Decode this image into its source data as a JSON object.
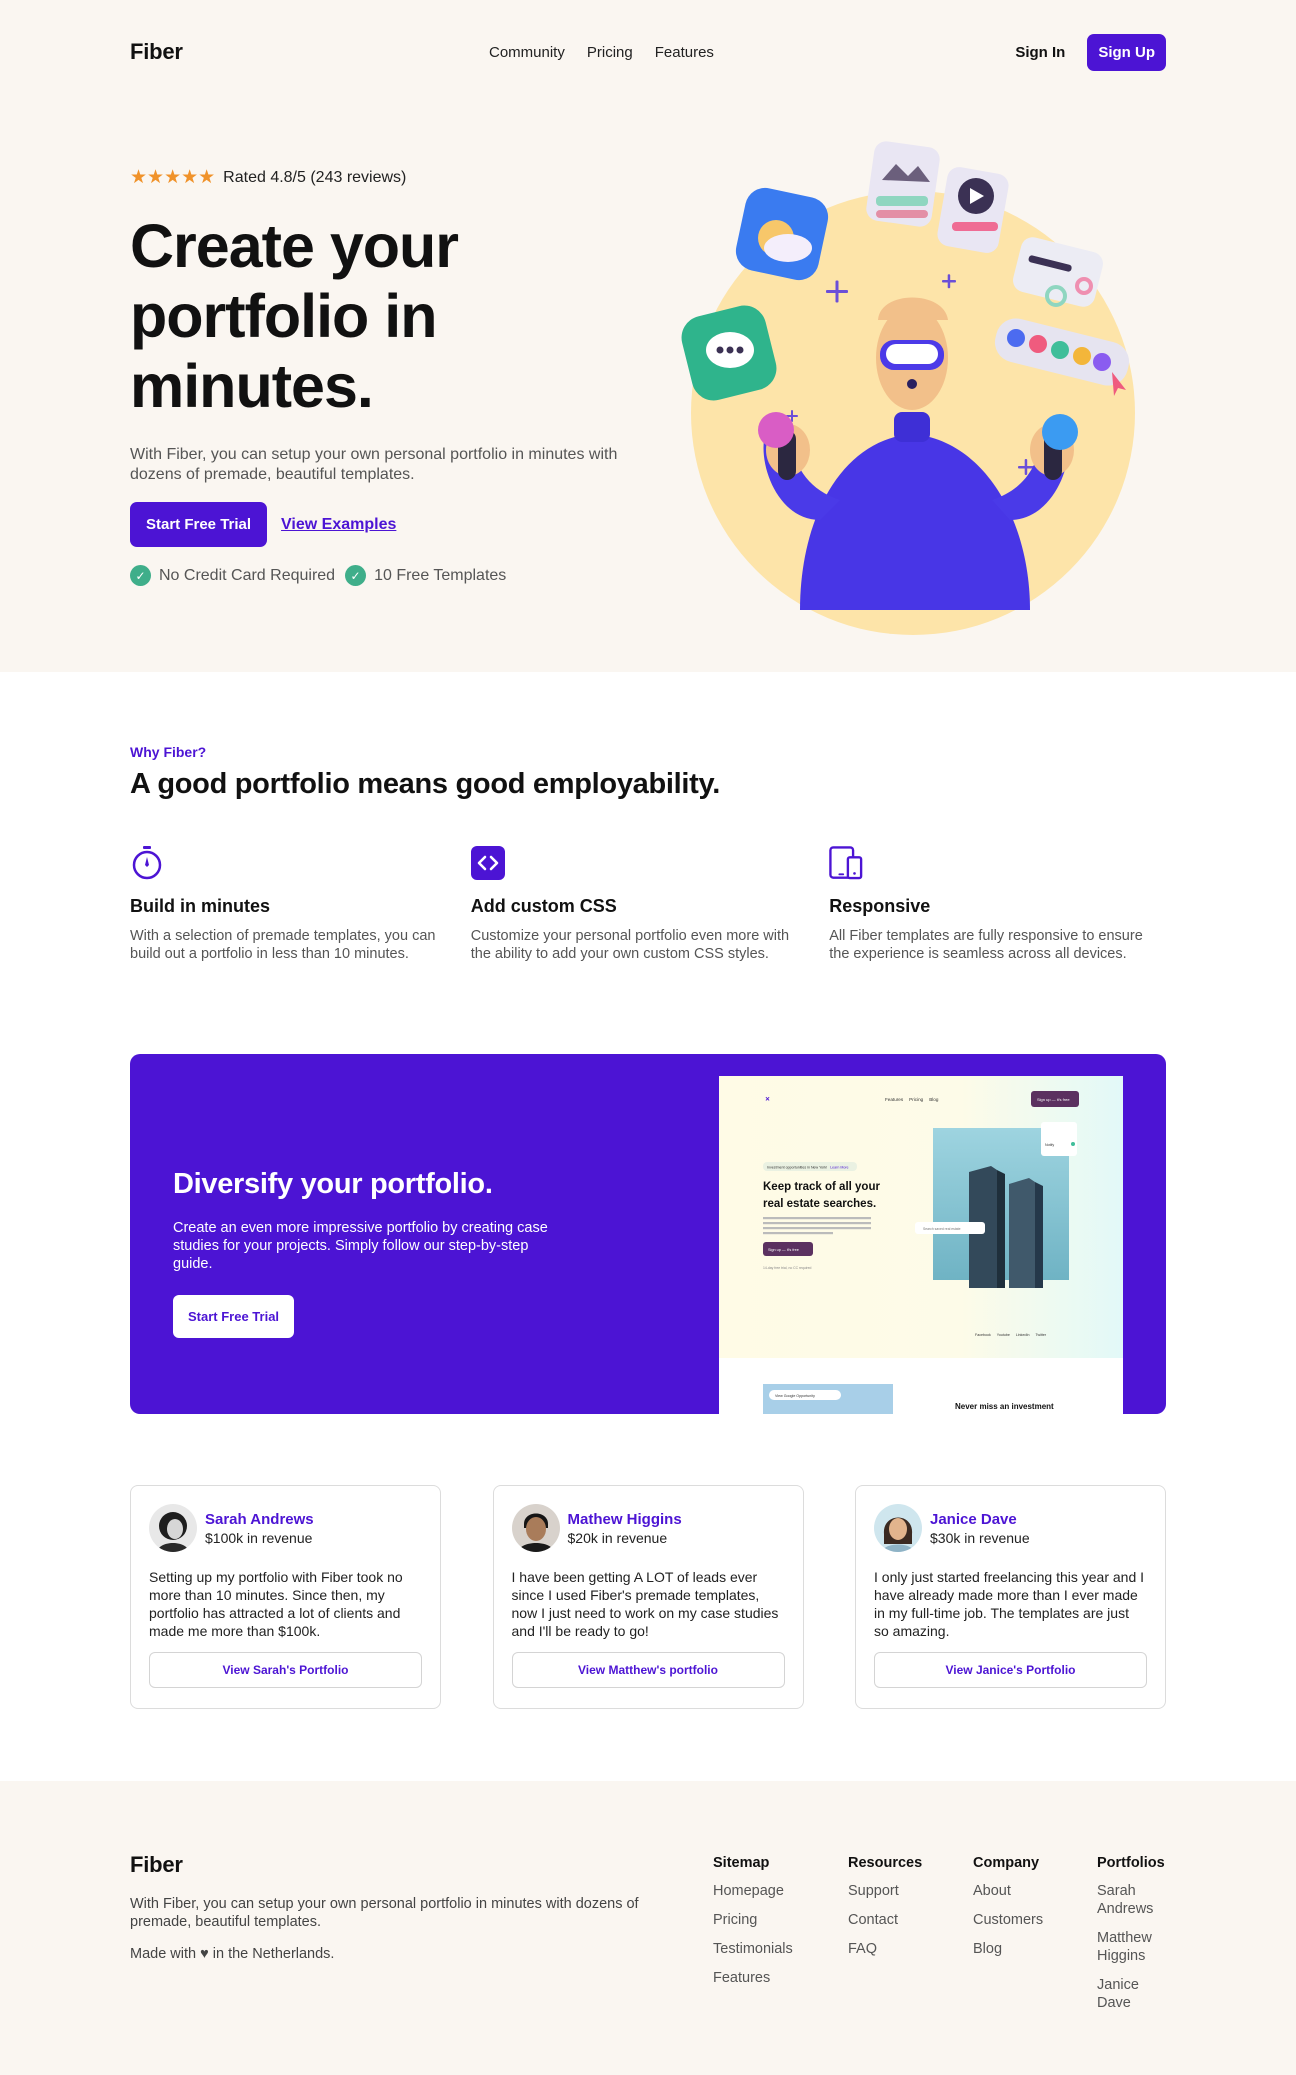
{
  "header": {
    "logo": "Fiber",
    "nav": [
      "Community",
      "Pricing",
      "Features"
    ],
    "sign_in": "Sign In",
    "sign_up": "Sign Up"
  },
  "hero": {
    "rating_text": "Rated 4.8/5 (243 reviews)",
    "rating_stars": 5,
    "title": "Create your portfolio in minutes.",
    "subtitle": "With Fiber, you can setup your own personal portfolio in minutes with dozens of premade, beautiful templates.",
    "cta_primary": "Start Free Trial",
    "cta_secondary": "View Examples",
    "checks": [
      "No Credit Card Required",
      "10 Free Templates"
    ]
  },
  "why": {
    "eyebrow": "Why Fiber?",
    "title": "A good portfolio means good employability.",
    "features": [
      {
        "icon": "stopwatch-icon",
        "title": "Build in minutes",
        "text": "With a selection of premade templates, you can build out a portfolio in less than 10 minutes."
      },
      {
        "icon": "code-icon",
        "title": "Add custom CSS",
        "text": "Customize your personal portfolio even more with the ability to add your own custom CSS styles."
      },
      {
        "icon": "devices-icon",
        "title": "Responsive",
        "text": "All Fiber templates are fully responsive to ensure the experience is seamless across all devices."
      }
    ]
  },
  "banner": {
    "title": "Diversify your portfolio.",
    "text": "Create an even more impressive portfolio by creating case studies for your projects. Simply follow our step-by-step guide.",
    "cta": "Start Free Trial",
    "preview": {
      "nav": [
        "Features",
        "Pricing",
        "Blog"
      ],
      "button": "Sign up — it's free",
      "pill": "Investment opportunities in New York!",
      "pill_link": "Learn More",
      "heading": "Keep track of all your real estate searches.",
      "body": "With Search Now — you have seamless integration with the most popular real estate search websites. Keep track of all your real estate search in one place with Schedule.",
      "small_button": "Sign up — it's free",
      "fineprint": "14-day free trial, no CC required",
      "search_placeholder": "Search saved real estate",
      "tag": "Notify",
      "socials": [
        "Facebook",
        "Youtube",
        "LinkedIn",
        "Twitter"
      ],
      "chip": "View Google Opportunity",
      "bottom_heading": "Never miss an investment"
    }
  },
  "testimonials": [
    {
      "name": "Sarah Andrews",
      "revenue": "$100k in revenue",
      "quote": "Setting up my portfolio with Fiber took no more than 10 minutes. Since then, my portfolio has attracted a lot of clients and made me more than $100k.",
      "button": "View Sarah's Portfolio"
    },
    {
      "name": "Mathew Higgins",
      "revenue": "$20k in revenue",
      "quote": "I have been getting A LOT of leads ever since I used Fiber's premade templates, now I just need to work on my case studies and I'll be ready to go!",
      "button": "View Matthew's portfolio"
    },
    {
      "name": "Janice Dave",
      "revenue": "$30k in revenue",
      "quote": "I only just started freelancing this year and I have already made more than I ever made in my full-time job. The templates are just so amazing.",
      "button": "View Janice's Portfolio"
    }
  ],
  "footer": {
    "logo": "Fiber",
    "text": "With Fiber, you can setup your own personal portfolio in minutes with dozens of premade, beautiful templates.",
    "made_with": "Made with ♥ in the Netherlands.",
    "columns": [
      {
        "title": "Sitemap",
        "links": [
          "Homepage",
          "Pricing",
          "Testimonials",
          "Features"
        ]
      },
      {
        "title": "Resources",
        "links": [
          "Support",
          "Contact",
          "FAQ"
        ]
      },
      {
        "title": "Company",
        "links": [
          "About",
          "Customers",
          "Blog"
        ]
      },
      {
        "title": "Portfolios",
        "links": [
          "Sarah Andrews",
          "Matthew Higgins",
          "Janice Dave"
        ]
      }
    ]
  },
  "colors": {
    "brand": "#4c14d4",
    "cream": "#faf6f1",
    "star": "#f0922a",
    "check": "#3fae8a"
  }
}
